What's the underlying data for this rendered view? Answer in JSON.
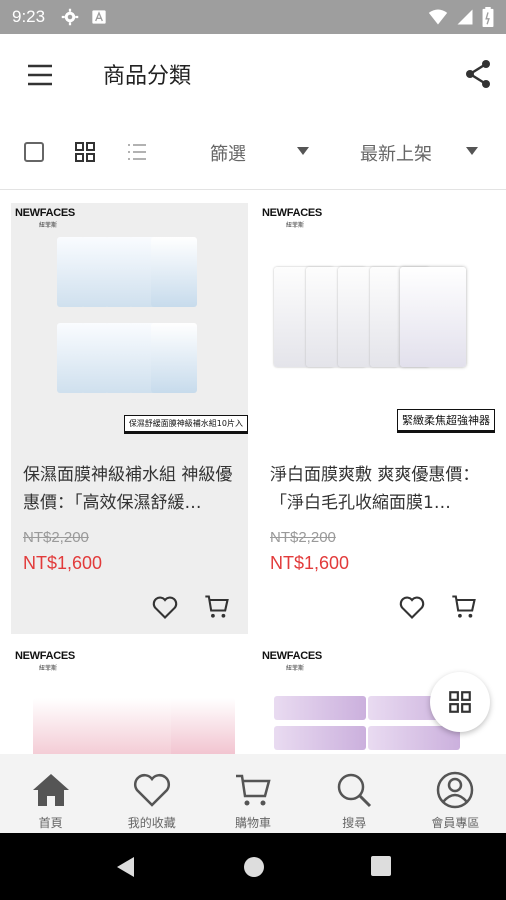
{
  "status_bar": {
    "time": "9:23"
  },
  "app_bar": {
    "title": "商品分類"
  },
  "toolbar": {
    "filter_label": "篩選",
    "sort_label": "最新上架"
  },
  "products": [
    {
      "brand": "NEWFACES",
      "brand_sub": "紐菲斯",
      "tagline": "保濕舒緩面膜神級補水組10片入",
      "name": "保濕面膜神級補水組 神級優惠價：「高效保濕舒緩…",
      "old_price": "NT$2,200",
      "new_price": "NT$1,600"
    },
    {
      "brand": "NEWFACES",
      "brand_sub": "紐菲斯",
      "tagline": "緊緻柔焦超強神器",
      "name": "淨白面膜爽敷 爽爽優惠價：「淨白毛孔收縮面膜1…",
      "old_price": "NT$2,200",
      "new_price": "NT$1,600"
    },
    {
      "brand": "NEWFACES",
      "brand_sub": "紐菲斯"
    },
    {
      "brand": "NEWFACES",
      "brand_sub": "紐菲斯"
    }
  ],
  "bottom_nav": {
    "items": [
      {
        "label": "首頁",
        "icon": "home-icon"
      },
      {
        "label": "我的收藏",
        "icon": "heart-icon"
      },
      {
        "label": "購物車",
        "icon": "cart-icon"
      },
      {
        "label": "搜尋",
        "icon": "search-icon"
      },
      {
        "label": "會員專區",
        "icon": "user-icon"
      }
    ]
  },
  "colors": {
    "price_red": "#e23b3b",
    "status_bar": "#9e9e9e",
    "nav_bg": "#f3f3f3"
  }
}
